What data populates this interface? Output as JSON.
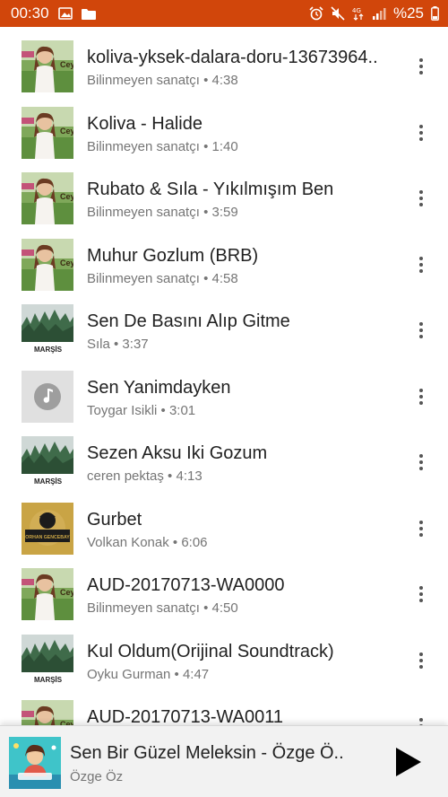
{
  "status_bar": {
    "time": "00:30",
    "battery": "%25",
    "icons": [
      "image-icon",
      "folder-icon",
      "alarm-icon",
      "mute-icon",
      "data-icon",
      "signal-icon",
      "battery-icon"
    ],
    "color": "#d1460b"
  },
  "songs": [
    {
      "title": "koliva-yksek-dalara-doru-13673964..",
      "subtitle": "Bilinmeyen sanatçı • 4:38",
      "art": "girl"
    },
    {
      "title": "Koliva - Halide",
      "subtitle": "Bilinmeyen sanatçı • 1:40",
      "art": "girl"
    },
    {
      "title": "Rubato & Sıla - Yıkılmışım Ben",
      "subtitle": "Bilinmeyen sanatçı • 3:59",
      "art": "girl"
    },
    {
      "title": "Muhur Gozlum (BRB)",
      "subtitle": "Bilinmeyen sanatçı • 4:58",
      "art": "girl"
    },
    {
      "title": "Sen De Basını Alıp Gitme",
      "subtitle": "Sıla • 3:37",
      "art": "forest"
    },
    {
      "title": "Sen Yanimdayken",
      "subtitle": "Toygar Isikli • 3:01",
      "art": "note"
    },
    {
      "title": "Sezen Aksu  Iki Gozum",
      "subtitle": "ceren pektaş • 4:13",
      "art": "forest"
    },
    {
      "title": "Gurbet",
      "subtitle": "Volkan Konak • 6:06",
      "art": "gold"
    },
    {
      "title": "AUD-20170713-WA0000",
      "subtitle": "Bilinmeyen sanatçı • 4:50",
      "art": "girl"
    },
    {
      "title": "Kul Oldum(Orijinal Soundtrack)",
      "subtitle": "Oyku Gurman • 4:47",
      "art": "forest"
    },
    {
      "title": "AUD-20170713-WA0011",
      "subtitle": "",
      "art": "girl"
    }
  ],
  "art_labels": {
    "girl_text": "Ceyl",
    "forest_text": "MARŞİS",
    "gold_text": "ORHAN GENCEBAY"
  },
  "now_playing": {
    "title": "Sen Bir Güzel Meleksin - Özge Ö..",
    "artist": "Özge Öz",
    "play_icon": "play-icon"
  }
}
